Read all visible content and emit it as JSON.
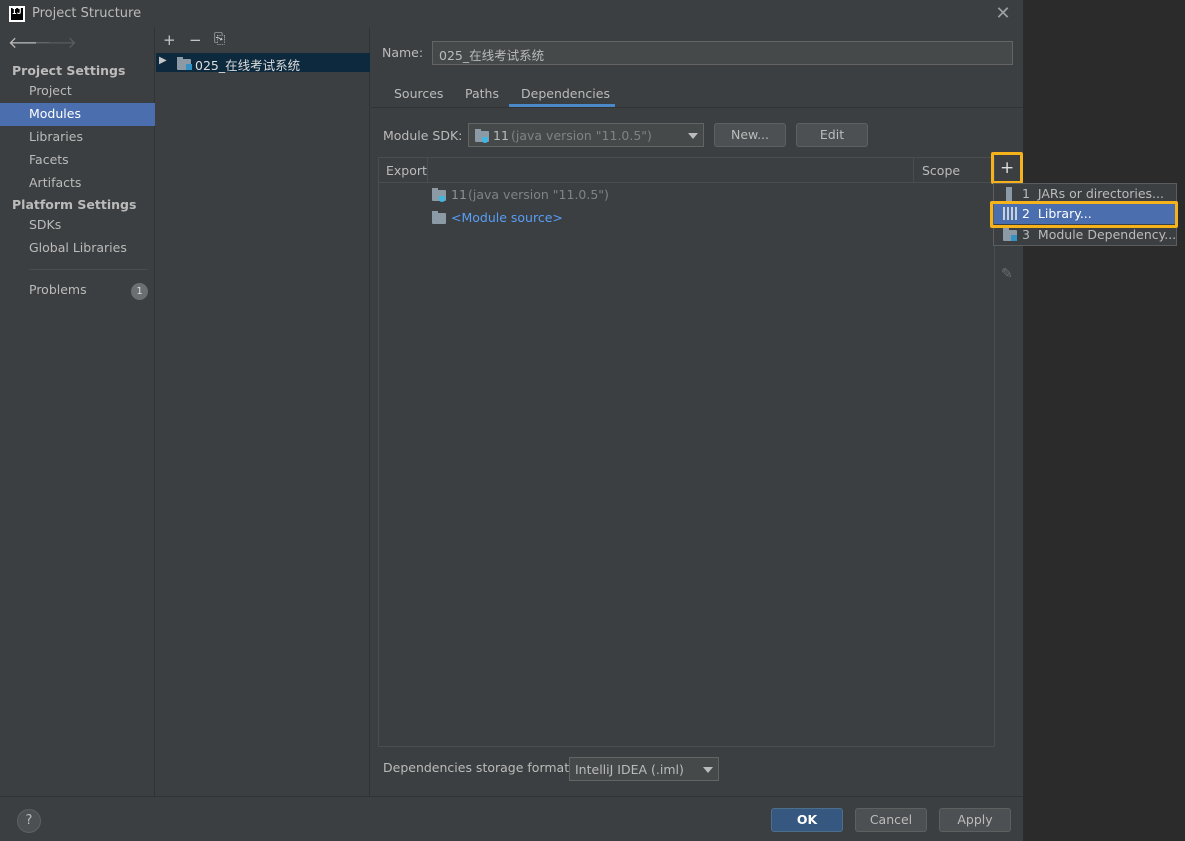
{
  "window": {
    "title": "Project Structure",
    "close_glyph": "✕"
  },
  "nav": {
    "back_glyph": "🡐",
    "forward_glyph": "🡒",
    "project_settings_header": "Project Settings",
    "project_items": [
      "Project",
      "Modules",
      "Libraries",
      "Facets",
      "Artifacts"
    ],
    "selected_item": "Modules",
    "platform_settings_header": "Platform Settings",
    "platform_items": [
      "SDKs",
      "Global Libraries"
    ],
    "problems_label": "Problems",
    "problems_count": "1"
  },
  "tree": {
    "add_glyph": "+",
    "remove_glyph": "−",
    "copy_glyph": "⎘",
    "module_name": "025_在线考试系统"
  },
  "module": {
    "name_label": "Name:",
    "name_value": "025_在线考试系统",
    "tabs": [
      "Sources",
      "Paths",
      "Dependencies"
    ],
    "active_tab": "Dependencies",
    "sdk_label": "Module SDK:",
    "sdk_value_main": "11",
    "sdk_value_detail": "(java version \"11.0.5\")",
    "new_button": "New...",
    "edit_button": "Edit"
  },
  "dependencies": {
    "columns": {
      "export": "Export",
      "scope": "Scope"
    },
    "rows": [
      {
        "main": "11",
        "detail": "(java version \"11.0.5\")",
        "type": "sdk"
      },
      {
        "main": "<Module source>",
        "detail": "",
        "type": "source"
      }
    ],
    "add_glyph": "+",
    "edit_glyph": "✎"
  },
  "add_menu": {
    "items": [
      {
        "number": "1",
        "label": "JARs or directories...",
        "icon": "jar-icon"
      },
      {
        "number": "2",
        "label": "Library...",
        "icon": "library-icon"
      },
      {
        "number": "3",
        "label": "Module Dependency...",
        "icon": "module-icon"
      }
    ],
    "selected": "2"
  },
  "storage": {
    "label": "Dependencies storage format:",
    "value": "IntelliJ IDEA (.iml)"
  },
  "footer": {
    "help_glyph": "?",
    "ok": "OK",
    "cancel": "Cancel",
    "apply": "Apply"
  },
  "colors": {
    "selection": "#4b6eaf",
    "highlight": "#f5b21b",
    "link": "#589df6",
    "primary_button": "#365880"
  }
}
